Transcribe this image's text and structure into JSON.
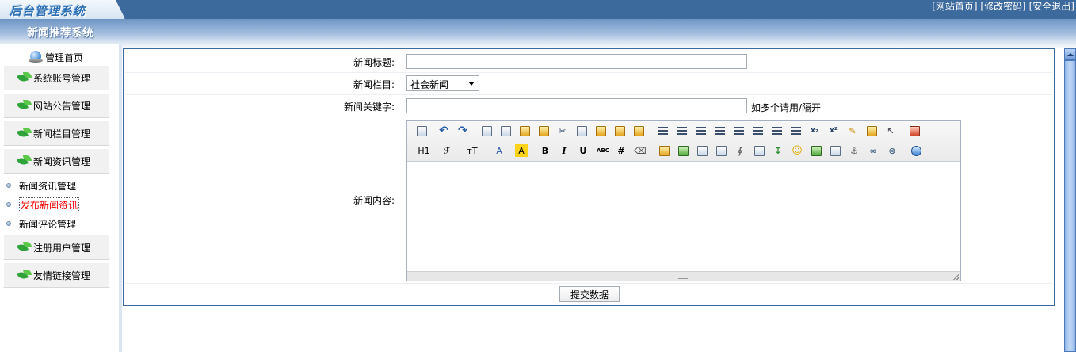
{
  "app": {
    "logo_text": "后台管理系统",
    "title": "新闻推荐系统"
  },
  "top_links": [
    "[网站首页]",
    "[修改密码]",
    "[安全退出]"
  ],
  "sidebar": {
    "home": "管理首页",
    "groups": [
      {
        "label": "系统账号管理",
        "icon": "leaf-icon"
      },
      {
        "label": "网站公告管理",
        "icon": "leaf-icon"
      },
      {
        "label": "新闻栏目管理",
        "icon": "leaf-icon"
      },
      {
        "label": "新闻资讯管理",
        "icon": "leaf-icon"
      },
      {
        "label": "注册用户管理",
        "icon": "leaf-icon"
      },
      {
        "label": "友情链接管理",
        "icon": "leaf-icon"
      }
    ],
    "subitems": [
      "新闻资讯管理",
      "发布新闻资讯",
      "新闻评论管理"
    ],
    "active_subitem": "发布新闻资讯"
  },
  "form": {
    "title_label": "新闻标题:",
    "title_value": "",
    "category_label": "新闻栏目:",
    "category_value": "社会新闻",
    "keyword_label": "新闻关键字:",
    "keyword_value": "",
    "keyword_hint": "如多个请用/隔开",
    "content_label": "新闻内容:",
    "submit_label": "提交数据"
  },
  "editor": {
    "toolbar_text": {
      "h1": "H1",
      "font": "ℱ",
      "size": "тT",
      "fontcolor": "A",
      "bgcolor": "A",
      "bold": "B",
      "italic": "I",
      "underline": "U",
      "strike": "ABC",
      "sub": "x₂",
      "sup": "x²"
    }
  },
  "colors": {
    "header": "#3d6a9c",
    "active_link": "#ee0000",
    "frame_border": "#3d6a9c"
  }
}
